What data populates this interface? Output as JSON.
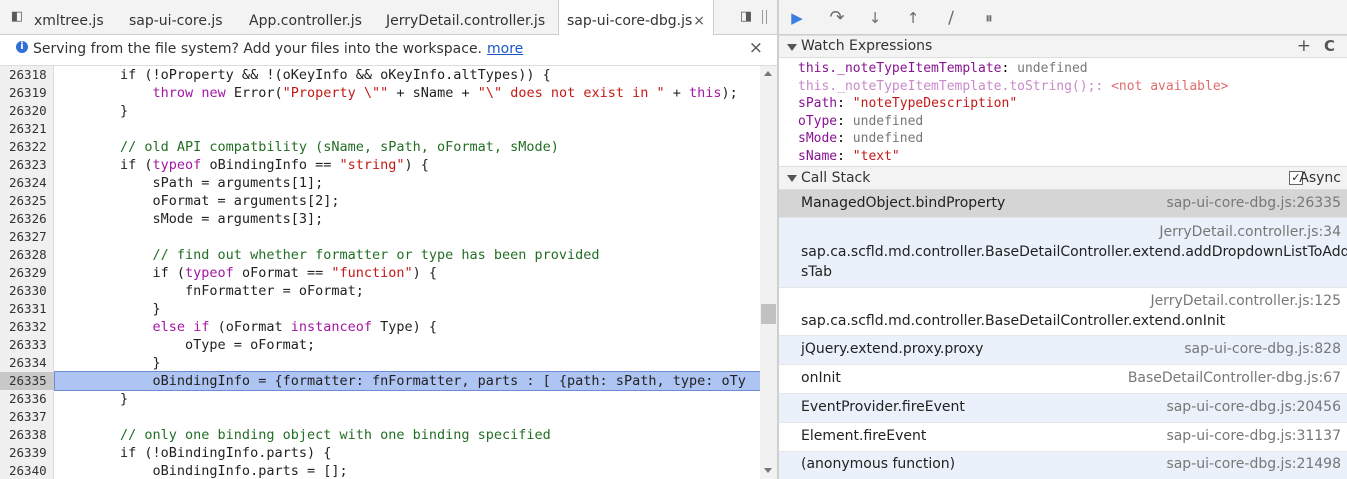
{
  "tabs": [
    {
      "label": "xmltree.js"
    },
    {
      "label": "sap-ui-core.js"
    },
    {
      "label": "App.controller.js"
    },
    {
      "label": "JerryDetail.controller.js"
    },
    {
      "label": "sap-ui-core-dbg.js",
      "active": true
    }
  ],
  "tab_close": "×",
  "infobar": {
    "text": "Serving from the file system? Add your files into the workspace.",
    "link": "more",
    "close": "×"
  },
  "editor": {
    "line_numbers": [
      "26318",
      "26319",
      "26320",
      "26321",
      "26322",
      "26323",
      "26324",
      "26325",
      "26326",
      "26327",
      "26328",
      "26329",
      "26330",
      "26331",
      "26332",
      "26333",
      "26334",
      "26335",
      "26336",
      "26337",
      "26338",
      "26339",
      "26340"
    ],
    "current_line": "26335"
  },
  "code": {
    "l0": {
      "a": "        if (!oProperty && !(oKeyInfo && oKeyInfo.altTypes)) {"
    },
    "l1": {
      "a": "            ",
      "k1": "throw",
      "b": " ",
      "k2": "new",
      "c": " Error(",
      "s1": "\"Property \\\"\"",
      "d": " + sName + ",
      "s2": "\"\\\" does not exist in \"",
      "e": " + ",
      "k3": "this",
      "f": ");"
    },
    "l2": {
      "a": "        }"
    },
    "l3": {
      "a": ""
    },
    "l4": {
      "cm": "        // old API compatbility (sName, sPath, oFormat, sMode)"
    },
    "l5": {
      "a": "        if (",
      "k1": "typeof",
      "b": " oBindingInfo == ",
      "s1": "\"string\"",
      "c": ") {"
    },
    "l6": {
      "a": "            sPath = arguments[1];"
    },
    "l7": {
      "a": "            oFormat = arguments[2];"
    },
    "l8": {
      "a": "            sMode = arguments[3];"
    },
    "l9": {
      "a": ""
    },
    "l10": {
      "cm": "            // find out whether formatter or type has been provided"
    },
    "l11": {
      "a": "            if (",
      "k1": "typeof",
      "b": " oFormat == ",
      "s1": "\"function\"",
      "c": ") {"
    },
    "l12": {
      "a": "                fnFormatter = oFormat;"
    },
    "l13": {
      "a": "            }"
    },
    "l14": {
      "a": "            ",
      "k1": "else",
      "b": " ",
      "k2": "if",
      "c": " (oFormat ",
      "k3": "instanceof",
      "d": " Type) {"
    },
    "l15": {
      "a": "                oType = oFormat;"
    },
    "l16": {
      "a": "            }"
    },
    "l17": {
      "a": "            oBindingInfo = {formatter: fnFormatter, parts : [ {path: sPath, type: oTy"
    },
    "l18": {
      "a": "        }"
    },
    "l19": {
      "a": ""
    },
    "l20": {
      "cm": "        // only one binding object with one binding specified"
    },
    "l21": {
      "a": "        if (!oBindingInfo.parts) {"
    },
    "l22": {
      "a": "            oBindingInfo.parts = [];"
    }
  },
  "watch": {
    "title": "Watch Expressions",
    "add": "+",
    "refresh": "C",
    "items": [
      {
        "name": "this._noteTypeItemTemplate",
        "sep": ": ",
        "value": "undefined"
      },
      {
        "name": "this._noteTypeItemTemplate.toString();",
        "sep": ": ",
        "value": "<not available>"
      },
      {
        "name": "sPath",
        "sep": ": ",
        "value": "\"noteTypeDescription\""
      },
      {
        "name": "oType",
        "sep": ": ",
        "value": "undefined"
      },
      {
        "name": "sMode",
        "sep": ": ",
        "value": "undefined"
      },
      {
        "name": "sName",
        "sep": ": ",
        "value": "\"text\""
      }
    ]
  },
  "callstack": {
    "title": "Call Stack",
    "async_label": "Async",
    "async_checked": true,
    "async_check": "✓",
    "frames": [
      {
        "name": "ManagedObject.bindProperty",
        "loc": "sap-ui-core-dbg.js:26335"
      },
      {
        "name_line1": "sap.ca.scfld.md.controller.BaseDetailController.extend.addDropdownListToAddres",
        "name_line2": "sTab",
        "loc": "JerryDetail.controller.js:34"
      },
      {
        "name": "sap.ca.scfld.md.controller.BaseDetailController.extend.onInit",
        "loc": "JerryDetail.controller.js:125"
      },
      {
        "name": "jQuery.extend.proxy.proxy",
        "loc": "sap-ui-core-dbg.js:828"
      },
      {
        "name": "onInit",
        "loc": "BaseDetailController-dbg.js:67"
      },
      {
        "name": "EventProvider.fireEvent",
        "loc": "sap-ui-core-dbg.js:20456"
      },
      {
        "name": "Element.fireEvent",
        "loc": "sap-ui-core-dbg.js:31137"
      },
      {
        "name": "(anonymous function)",
        "loc": "sap-ui-core-dbg.js:21498"
      }
    ]
  },
  "icons": {
    "navigator_toggle": "◧",
    "sidebar_toggle": "◨",
    "info": "i",
    "resume": "▶",
    "step_over": "↷",
    "step_into": "↓",
    "step_out": "↑",
    "deactivate_breakpoints": "⧸",
    "pause_exceptions": "⏸"
  }
}
